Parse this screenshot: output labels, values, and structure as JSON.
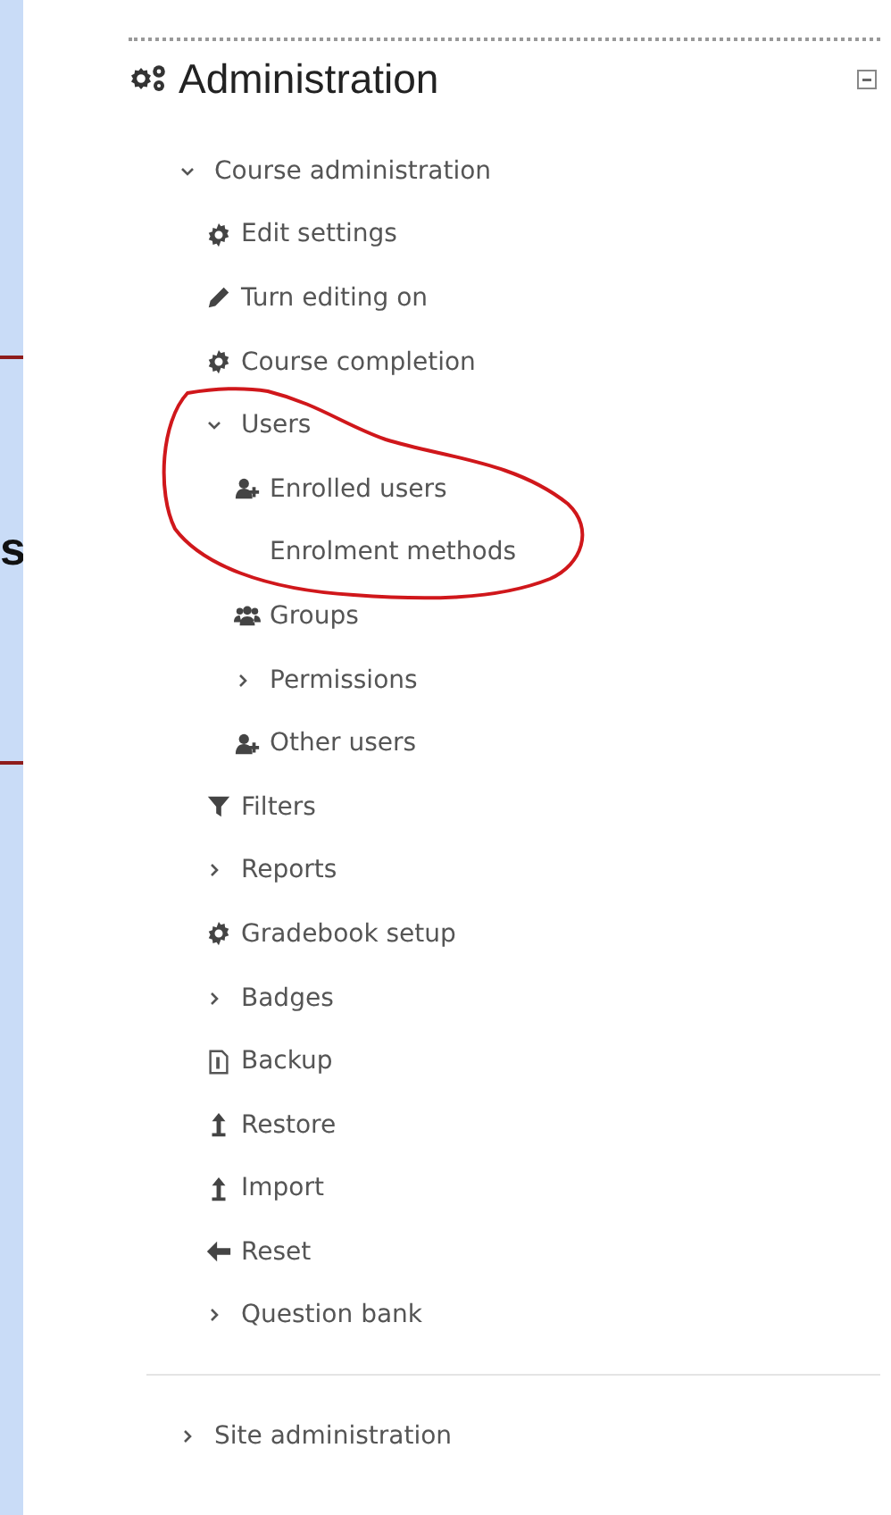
{
  "slide_edge": {
    "text": "s"
  },
  "block": {
    "title": "Administration",
    "tree": [
      {
        "label": "Course administration",
        "kind": "branch",
        "expanded": true,
        "children": [
          {
            "label": "Edit settings",
            "kind": "settings"
          },
          {
            "label": "Turn editing on",
            "kind": "edit"
          },
          {
            "label": "Course completion",
            "kind": "settings"
          },
          {
            "label": "Users",
            "kind": "branch",
            "expanded": true,
            "children": [
              {
                "label": "Enrolled users",
                "kind": "enrol"
              },
              {
                "label": "Enrolment methods",
                "kind": "plain"
              },
              {
                "label": "Groups",
                "kind": "groups"
              },
              {
                "label": "Permissions",
                "kind": "branch",
                "expanded": false
              },
              {
                "label": "Other users",
                "kind": "enrol"
              }
            ]
          },
          {
            "label": "Filters",
            "kind": "filter"
          },
          {
            "label": "Reports",
            "kind": "branch",
            "expanded": false
          },
          {
            "label": "Gradebook setup",
            "kind": "settings"
          },
          {
            "label": "Badges",
            "kind": "branch",
            "expanded": false
          },
          {
            "label": "Backup",
            "kind": "backup"
          },
          {
            "label": "Restore",
            "kind": "upload"
          },
          {
            "label": "Import",
            "kind": "upload"
          },
          {
            "label": "Reset",
            "kind": "reset"
          },
          {
            "label": "Question bank",
            "kind": "branch",
            "expanded": false
          }
        ]
      }
    ],
    "site_tree": [
      {
        "label": "Site administration",
        "kind": "branch",
        "expanded": false
      }
    ]
  }
}
